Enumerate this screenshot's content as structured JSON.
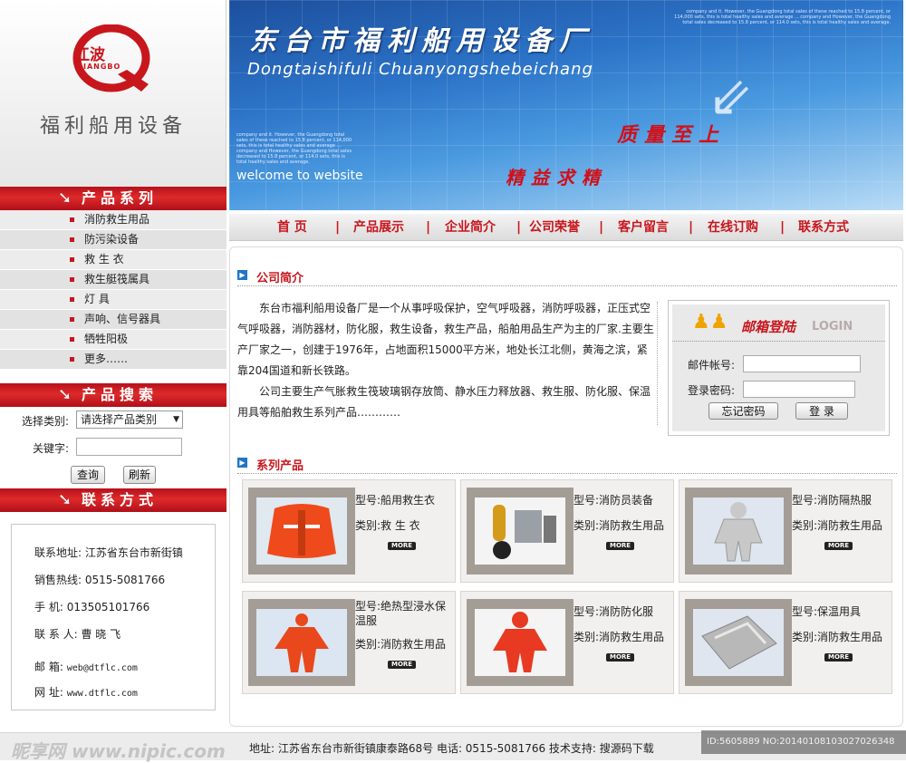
{
  "logo": {
    "cn": "江波",
    "en": "JIANGBO",
    "brand": "福利船用设备"
  },
  "left": {
    "products_title": "产品系列",
    "products": [
      "消防救生用品",
      "防污染设备",
      "救 生 衣",
      "救生艇筏属具",
      "灯 具",
      "声响、信号器具",
      "牺牲阳极",
      "更多……"
    ],
    "search_title": "产品搜索",
    "search": {
      "category_label": "选择类别:",
      "category_value": "请选择产品类别",
      "keyword_label": "关键字:",
      "query_button": "查询",
      "refresh_button": "刷新"
    },
    "contact_title": "联系方式",
    "contact": {
      "address": "联系地址: 江苏省东台市新街镇",
      "hotline": "销售热线: 0515-5081766",
      "mobile_label": "手    机:",
      "mobile": "013505101766",
      "person": "联 系 人: 曹 晓 飞",
      "email_label": "邮    箱:",
      "email": "web@dtflc.com",
      "site_label": "网    址:",
      "site": "www.dtflc.com"
    }
  },
  "banner": {
    "title_cn": "东台市福利船用设备厂",
    "title_en": "Dongtaishifuli Chuanyongshebeichang",
    "slogan1": "质量至上",
    "slogan2": "精益求精",
    "welcome": "welcome to website",
    "small_text": "company and it. However, the Guangdong total sales of these reached to 15.8 percent, or 114,000 sets, this is total healthy sales and average ... company and However, the Guangdong total sales decreased to 15.8 percent, or 114.0 sets, this is total healthy sales and average."
  },
  "nav": {
    "items": [
      "首  页",
      "产品展示",
      "企业简介",
      "公司荣誉",
      "客户留言",
      "在线订购",
      "联系方式"
    ],
    "sep": "|"
  },
  "about": {
    "title": "公司简介",
    "para1": "东台市福利船用设备厂是一个从事呼吸保护，空气呼吸器，消防呼吸器，正压式空气呼吸器，消防器材，防化服，救生设备，救生产品，船舶用品生产为主的厂家.主要生产厂家之一，创建于1976年，占地面积15000平方米，地处长江北侧，黄海之滨，紧靠204国道和新长铁路。",
    "para2": "公司主要生产气胀救生筏玻璃钢存放筒、静水压力释放器、救生服、防化服、保温用具等船舶救生系列产品…………"
  },
  "login": {
    "title": "邮箱登陆",
    "title_en": "LOGIN",
    "account_label": "邮件帐号:",
    "password_label": "登录密码:",
    "forgot_button": "忘记密码",
    "login_button": "登  录"
  },
  "products_section": {
    "title": "系列产品",
    "model_label": "型号:",
    "category_label": "类别:",
    "more": "MORE",
    "items": [
      {
        "model": "船用救生衣",
        "category": "救 生 衣"
      },
      {
        "model": "消防员装备",
        "category": "消防救生用品"
      },
      {
        "model": "消防隔热服",
        "category": "消防救生用品"
      },
      {
        "model": "绝热型浸水保温服",
        "category": "消防救生用品"
      },
      {
        "model": "消防防化服",
        "category": "消防救生用品"
      },
      {
        "model": "保温用具",
        "category": "消防救生用品"
      }
    ]
  },
  "footer": {
    "text": "地址: 江苏省东台市新街镇康泰路68号    电话: 0515-5081766  技术支持: 搜源码下载",
    "watermark_left": "昵享网 www.nipic.com",
    "watermark_right": "ID:5605889 NO:20140108103027026348"
  },
  "colors": {
    "accent_red": "#c8161d",
    "nav_blue": "#1f75c8"
  }
}
